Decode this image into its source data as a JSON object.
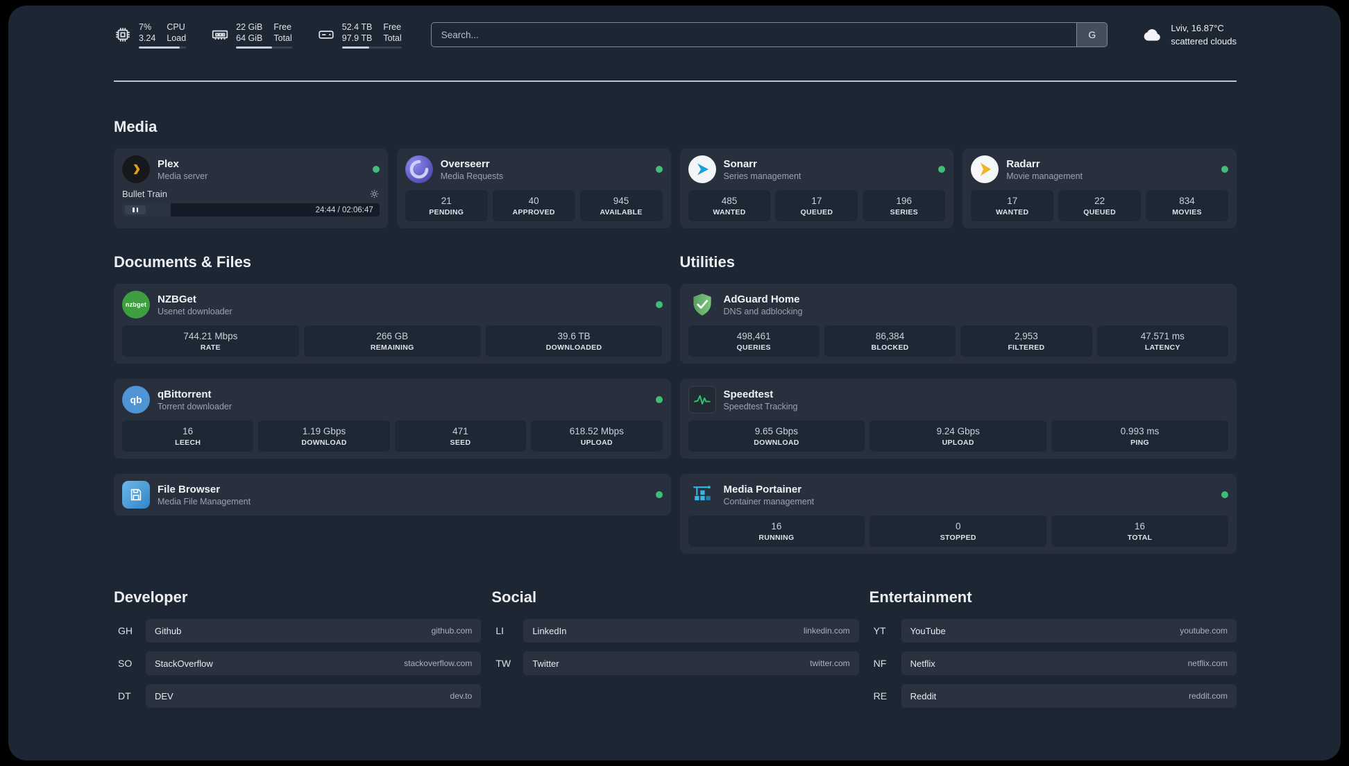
{
  "colors": {
    "background": "#1d2633",
    "card": "#28303d",
    "status_online": "#42bd78",
    "plex_accent": "#e5a00d"
  },
  "topbar": {
    "cpu": {
      "icon": "cpu-chip-icon",
      "value1": "7%",
      "value2": "3.24",
      "label1": "CPU",
      "label2": "Load",
      "bar_percent": 87
    },
    "memory": {
      "icon": "ram-icon",
      "value1": "22 GiB",
      "value2": "64 GiB",
      "label1": "Free",
      "label2": "Total",
      "bar_percent": 64
    },
    "disk": {
      "icon": "disk-icon",
      "value1": "52.4 TB",
      "value2": "97.9 TB",
      "label1": "Free",
      "label2": "Total",
      "bar_percent": 46
    },
    "search": {
      "placeholder": "Search...",
      "provider_label": "G"
    },
    "weather": {
      "icon": "cloud-icon",
      "location": "Lviv, 16.87°C",
      "condition": "scattered clouds"
    }
  },
  "sections": {
    "media": {
      "title": "Media",
      "cards": [
        {
          "name": "Plex",
          "desc": "Media server",
          "online": true,
          "player": {
            "track": "Bullet Train",
            "time": "24:44 / 02:06:47",
            "progress_percent": 19
          }
        },
        {
          "name": "Overseerr",
          "desc": "Media Requests",
          "online": true,
          "stats": [
            {
              "value": "21",
              "label": "PENDING"
            },
            {
              "value": "40",
              "label": "APPROVED"
            },
            {
              "value": "945",
              "label": "AVAILABLE"
            }
          ]
        },
        {
          "name": "Sonarr",
          "desc": "Series management",
          "online": true,
          "stats": [
            {
              "value": "485",
              "label": "WANTED"
            },
            {
              "value": "17",
              "label": "QUEUED"
            },
            {
              "value": "196",
              "label": "SERIES"
            }
          ]
        },
        {
          "name": "Radarr",
          "desc": "Movie management",
          "online": true,
          "stats": [
            {
              "value": "17",
              "label": "WANTED"
            },
            {
              "value": "22",
              "label": "QUEUED"
            },
            {
              "value": "834",
              "label": "MOVIES"
            }
          ]
        }
      ]
    },
    "documents": {
      "title": "Documents & Files",
      "cards": [
        {
          "name": "NZBGet",
          "desc": "Usenet downloader",
          "online": true,
          "icon_text": "nzbget",
          "stats": [
            {
              "value": "744.21 Mbps",
              "label": "RATE"
            },
            {
              "value": "266 GB",
              "label": "REMAINING"
            },
            {
              "value": "39.6 TB",
              "label": "DOWNLOADED"
            }
          ]
        },
        {
          "name": "qBittorrent",
          "desc": "Torrent downloader",
          "online": true,
          "icon_text": "qb",
          "stats": [
            {
              "value": "16",
              "label": "LEECH"
            },
            {
              "value": "1.19 Gbps",
              "label": "DOWNLOAD"
            },
            {
              "value": "471",
              "label": "SEED"
            },
            {
              "value": "618.52 Mbps",
              "label": "UPLOAD"
            }
          ]
        },
        {
          "name": "File Browser",
          "desc": "Media File Management",
          "online": true
        }
      ]
    },
    "utilities": {
      "title": "Utilities",
      "cards": [
        {
          "name": "AdGuard Home",
          "desc": "DNS and adblocking",
          "stats": [
            {
              "value": "498,461",
              "label": "QUERIES"
            },
            {
              "value": "86,384",
              "label": "BLOCKED"
            },
            {
              "value": "2,953",
              "label": "FILTERED"
            },
            {
              "value": "47.571 ms",
              "label": "LATENCY"
            }
          ]
        },
        {
          "name": "Speedtest",
          "desc": "Speedtest Tracking",
          "stats": [
            {
              "value": "9.65 Gbps",
              "label": "DOWNLOAD"
            },
            {
              "value": "9.24 Gbps",
              "label": "UPLOAD"
            },
            {
              "value": "0.993 ms",
              "label": "PING"
            }
          ]
        },
        {
          "name": "Media Portainer",
          "desc": "Container management",
          "online": true,
          "stats": [
            {
              "value": "16",
              "label": "RUNNING"
            },
            {
              "value": "0",
              "label": "STOPPED"
            },
            {
              "value": "16",
              "label": "TOTAL"
            }
          ]
        }
      ]
    }
  },
  "bookmarks": [
    {
      "title": "Developer",
      "items": [
        {
          "abbr": "GH",
          "name": "Github",
          "url": "github.com"
        },
        {
          "abbr": "SO",
          "name": "StackOverflow",
          "url": "stackoverflow.com"
        },
        {
          "abbr": "DT",
          "name": "DEV",
          "url": "dev.to"
        }
      ]
    },
    {
      "title": "Social",
      "items": [
        {
          "abbr": "LI",
          "name": "LinkedIn",
          "url": "linkedin.com"
        },
        {
          "abbr": "TW",
          "name": "Twitter",
          "url": "twitter.com"
        }
      ]
    },
    {
      "title": "Entertainment",
      "items": [
        {
          "abbr": "YT",
          "name": "YouTube",
          "url": "youtube.com"
        },
        {
          "abbr": "NF",
          "name": "Netflix",
          "url": "netflix.com"
        },
        {
          "abbr": "RE",
          "name": "Reddit",
          "url": "reddit.com"
        }
      ]
    }
  ]
}
